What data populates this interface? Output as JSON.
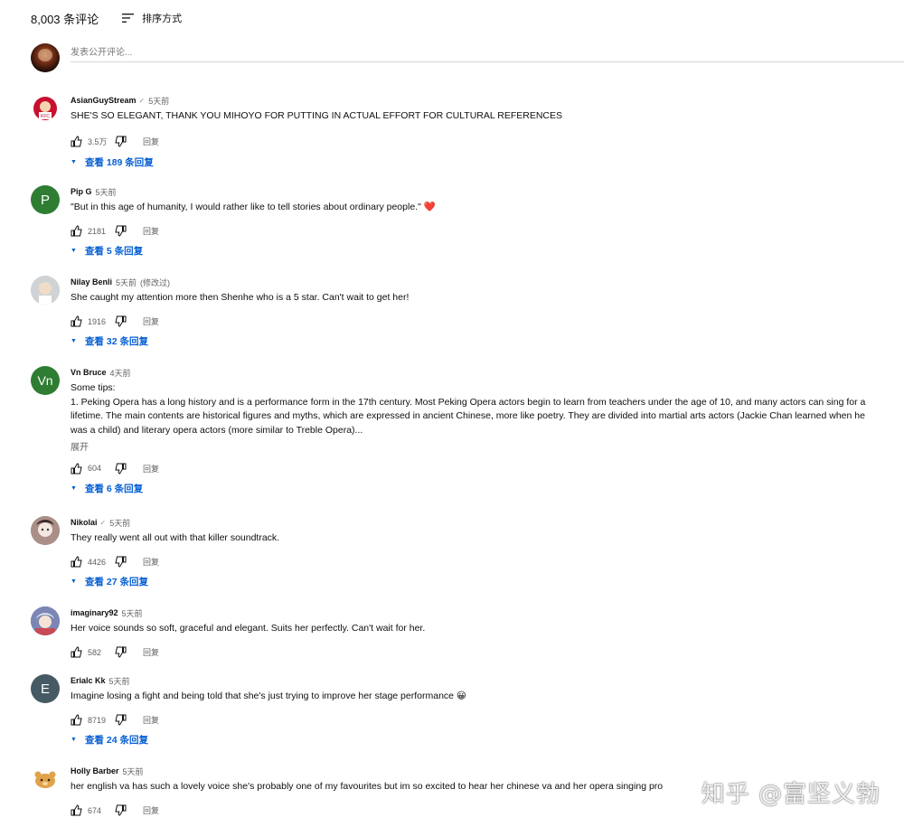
{
  "header": {
    "count_label": "8,003 条评论",
    "sort_label": "排序方式"
  },
  "compose": {
    "placeholder": "发表公开评论..."
  },
  "comments": [
    {
      "author": "AsianGuyStream",
      "verified": "✓",
      "time": "5天前",
      "edited": "",
      "text": "SHE'S SO ELEGANT, THANK YOU MIHOYO FOR PUTTING IN ACTUAL EFFORT FOR CULTURAL REFERENCES",
      "expand": "",
      "likes": "3.5万",
      "reply": "回复",
      "replies": "查看 189 条回复",
      "avatar_letter": ""
    },
    {
      "author": "Pip G",
      "verified": "",
      "time": "5天前",
      "edited": "",
      "text": "\"But in this age of humanity, I would rather like to tell stories about ordinary people.\" ❤️",
      "expand": "",
      "likes": "2181",
      "reply": "回复",
      "replies": "查看 5 条回复",
      "avatar_letter": "P"
    },
    {
      "author": "Nilay Benli",
      "verified": "",
      "time": "5天前",
      "edited": "(修改过)",
      "text": "She caught my attention more then Shenhe who is a 5 star. Can't wait to get her!",
      "expand": "",
      "likes": "1916",
      "reply": "回复",
      "replies": "查看 32 条回复",
      "avatar_letter": ""
    },
    {
      "author": "Vn Bruce",
      "verified": "",
      "time": "4天前",
      "edited": "",
      "text": "Some tips:\n1. Peking Opera has a long history and is a performance form in the 17th century. Most Peking Opera actors begin to learn from teachers under the age of 10, and many actors can sing for a\nlifetime. The main contents are historical figures and myths, which are expressed in ancient Chinese, more like poetry. They are divided into martial arts actors (Jackie Chan learned when he\nwas a child) and literary opera actors (more similar to Treble Opera)...",
      "expand": "展开",
      "likes": "604",
      "reply": "回复",
      "replies": "查看 6 条回复",
      "avatar_letter": "Vn"
    },
    {
      "author": "Nikolai",
      "verified": "✓",
      "time": "5天前",
      "edited": "",
      "text": "They really went all out with that killer soundtrack.",
      "expand": "",
      "likes": "4426",
      "reply": "回复",
      "replies": "查看 27 条回复",
      "avatar_letter": ""
    },
    {
      "author": "imaginary92",
      "verified": "",
      "time": "5天前",
      "edited": "",
      "text": "Her voice sounds so soft, graceful and elegant. Suits her perfectly. Can't wait for her.",
      "expand": "",
      "likes": "582",
      "reply": "回复",
      "replies": "",
      "avatar_letter": ""
    },
    {
      "author": "Erialc Kk",
      "verified": "",
      "time": "5天前",
      "edited": "",
      "text": "Imagine losing a fight and being told that she's just trying to improve her stage performance 😀",
      "expand": "",
      "likes": "8719",
      "reply": "回复",
      "replies": "查看 24 条回复",
      "avatar_letter": "E"
    },
    {
      "author": "Holly Barber",
      "verified": "",
      "time": "5天前",
      "edited": "",
      "text": "her english va has such a lovely voice she's probably one of my favourites but im so excited to hear her chinese va and her opera singing pro",
      "expand": "",
      "likes": "674",
      "reply": "回复",
      "replies": "",
      "avatar_letter": ""
    }
  ],
  "watermark": "知乎 @富坚义勃",
  "colors": {
    "link": "#065fd4",
    "muted": "#606060",
    "pip_avatar": "#2e7d32",
    "vn_avatar": "#2e7d32",
    "erialc_avatar": "#455a64"
  }
}
